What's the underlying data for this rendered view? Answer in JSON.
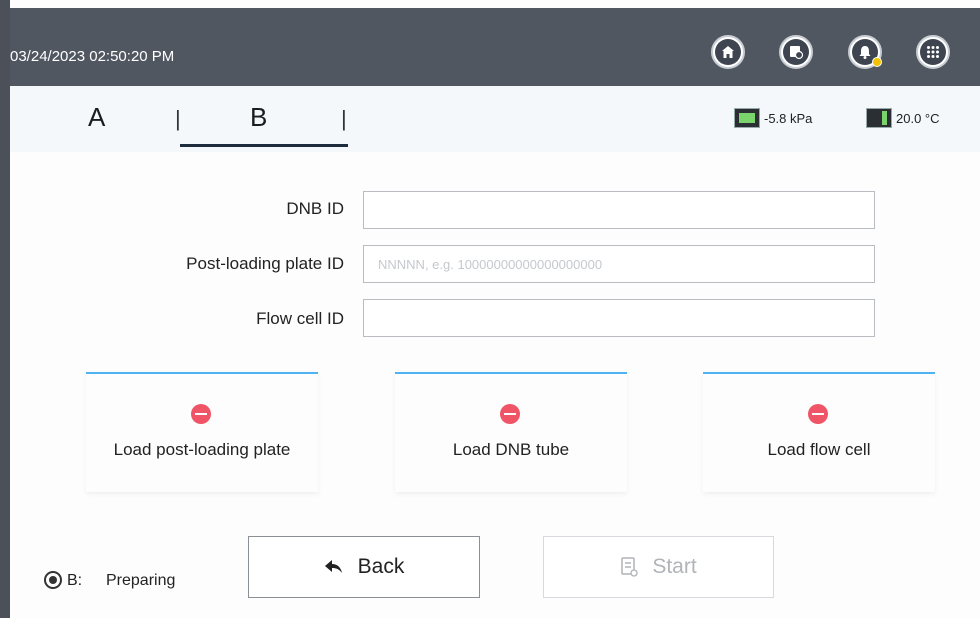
{
  "header": {
    "datetime": "03/24/2023 02:50:20 PM",
    "icons": [
      "home-icon",
      "zoom-icon",
      "bell-icon",
      "apps-grid-icon"
    ]
  },
  "tabs": {
    "a_label": "A",
    "b_label": "B",
    "separator": "|",
    "active": "B"
  },
  "sensors": {
    "pressure": "-5.8 kPa",
    "temperature": "20.0 °C"
  },
  "form": {
    "dnb_label": "DNB ID",
    "dnb_value": "",
    "plate_label": "Post-loading plate ID",
    "plate_placeholder": "NNNNN, e.g. 10000000000000000000",
    "flow_label": "Flow cell ID",
    "flow_value": ""
  },
  "cards": {
    "plate_label": "Load post-loading plate",
    "dnb_label": "Load DNB tube",
    "flow_label": "Load flow cell"
  },
  "status": {
    "prefix": "B:",
    "text": "Preparing"
  },
  "buttons": {
    "back_label": "Back",
    "start_label": "Start"
  },
  "colors": {
    "topbar": "#515761",
    "accent_blue": "#4fb3f2",
    "status_red": "#f05467",
    "bell_badge": "#f2c200"
  }
}
